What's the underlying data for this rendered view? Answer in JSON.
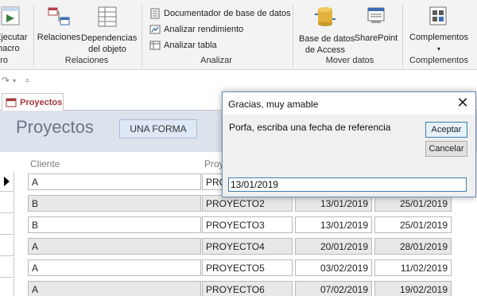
{
  "ribbon": {
    "run_macro_label": "Ejecutar\nmacro",
    "macro_group_label": "Macro",
    "relations_label": "Relaciones",
    "dependencies_label": "Dependencias\ndel objeto",
    "relations_group_label": "Relaciones",
    "db_documenter_label": "Documentador de base de datos",
    "analyze_performance_label": "Analizar rendimiento",
    "analyze_table_label": "Analizar tabla",
    "analyze_group_label": "Analizar",
    "access_db_label": "Base de datos\nde Access",
    "sharepoint_label": "SharePoint",
    "move_data_group_label": "Mover datos",
    "addins_label": "Complementos",
    "addins_group_label": "Complementos"
  },
  "qat": {
    "undo_icon": "undo-icon",
    "customize_icon": "customize-qat-icon"
  },
  "doc_tab": {
    "label": "Proyectos"
  },
  "form": {
    "title": "Proyectos",
    "button_label": "UNA FORMA",
    "columns": {
      "client": "Cliente",
      "project": "Proyecto"
    },
    "rows": [
      {
        "client": "A",
        "project": "PROYECTO1",
        "start": "",
        "end": ""
      },
      {
        "client": "B",
        "project": "PROYECTO2",
        "start": "13/01/2019",
        "end": "25/01/2019"
      },
      {
        "client": "B",
        "project": "PROYECTO3",
        "start": "13/01/2019",
        "end": "25/01/2019"
      },
      {
        "client": "A",
        "project": "PROYECTO4",
        "start": "20/01/2019",
        "end": "28/01/2019"
      },
      {
        "client": "A",
        "project": "PROYECTO5",
        "start": "03/02/2019",
        "end": "11/02/2019"
      },
      {
        "client": "A",
        "project": "PROYECTO6",
        "start": "07/02/2019",
        "end": "19/02/2019"
      }
    ]
  },
  "dialog": {
    "title": "Gracias, muy amable",
    "prompt": "Porfa, escriba una fecha de referencia",
    "ok_label": "Aceptar",
    "cancel_label": "Cancelar",
    "input_value": "13/01/2019"
  },
  "colors": {
    "accent": "#a4373a",
    "form_header": "#dde3ec",
    "dialog_border": "#6d8fbf"
  }
}
